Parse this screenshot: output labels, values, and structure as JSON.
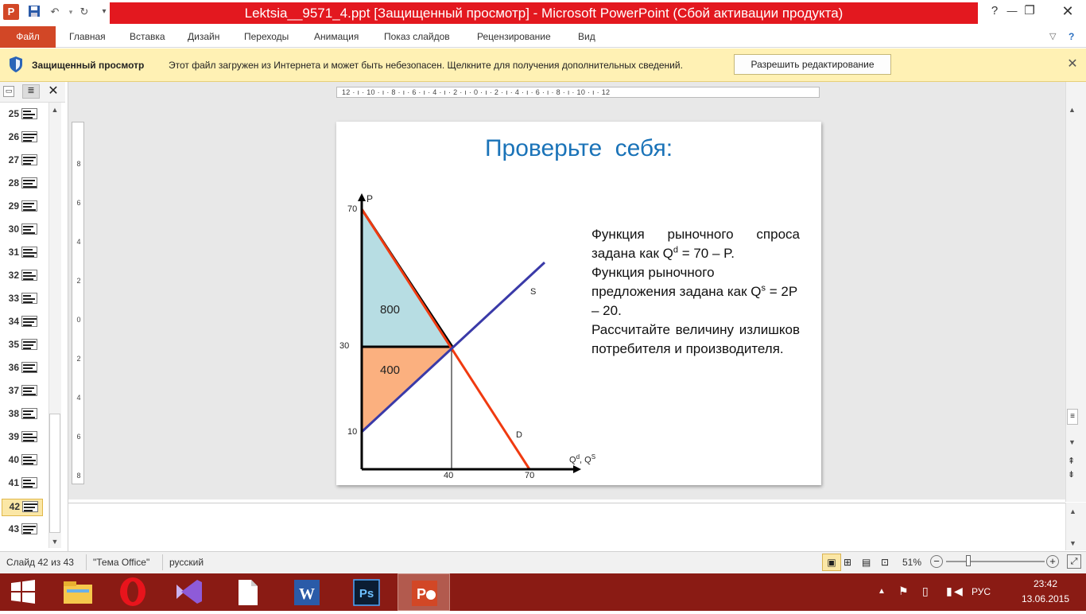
{
  "window": {
    "title": "Lektsia__9571_4.ppt [Защищенный просмотр]  -  Microsoft PowerPoint (Сбой активации продукта)",
    "app_icon_letter": "P"
  },
  "ribbon": {
    "file_tab": "Файл",
    "tabs": [
      "Главная",
      "Вставка",
      "Дизайн",
      "Переходы",
      "Анимация",
      "Показ слайдов",
      "Рецензирование",
      "Вид"
    ]
  },
  "message_bar": {
    "title": "Защищенный просмотр",
    "text": "Этот файл загружен из Интернета и может быть небезопасен. Щелкните для получения дополнительных сведений.",
    "button": "Разрешить редактирование",
    "bg_color": "#fff1b4"
  },
  "slide_thumbnails": [
    {
      "num": "25"
    },
    {
      "num": "26"
    },
    {
      "num": "27"
    },
    {
      "num": "28"
    },
    {
      "num": "29"
    },
    {
      "num": "30"
    },
    {
      "num": "31"
    },
    {
      "num": "32"
    },
    {
      "num": "33"
    },
    {
      "num": "34"
    },
    {
      "num": "35"
    },
    {
      "num": "36"
    },
    {
      "num": "37"
    },
    {
      "num": "38"
    },
    {
      "num": "39"
    },
    {
      "num": "40"
    },
    {
      "num": "41"
    },
    {
      "num": "42",
      "selected": true
    },
    {
      "num": "43"
    }
  ],
  "ruler": {
    "horizontal": "12 · ı · 10 · ı · 8 · ı · 6 · ı · 4 · ı · 2 · ı · 0 · ı · 2 · ı · 4 · ı · 6 · ı · 8 · ı · 10 · ı · 12",
    "vertical": [
      "8",
      "6",
      "4",
      "2",
      "0",
      "2",
      "4",
      "6",
      "8"
    ]
  },
  "slide": {
    "title": "Проверьте себя:",
    "title_color": "#1a73b8",
    "task": {
      "line1": "Функция рыночного спроса задана как Q",
      "line1_sup": "d",
      "line1_end": " = 70 – P.",
      "line2": "Функция рыночного предложения задана как Q",
      "line2_sup": "s",
      "line2_end": " = 2P – 20.",
      "line3": "Рассчитайте величину излишков потребителя и производителя."
    },
    "graph": {
      "y_axis_label": "P",
      "x_axis_label": "Q",
      "x_axis_sup1": "d",
      "x_axis_sep": ", Q",
      "x_axis_sup2": "S",
      "y_ticks": [
        "70",
        "30",
        "10"
      ],
      "x_ticks": [
        "40",
        "70"
      ],
      "supply_label": "S",
      "demand_label": "D",
      "consumer_surplus": "800",
      "producer_surplus": "400",
      "consumer_color": "#b7dde3",
      "producer_color": "#fbb07f",
      "demand_color": "#f03a10",
      "supply_color": "#3a3aa8"
    }
  },
  "status": {
    "slide_info": "Слайд 42 из 43",
    "theme": "\"Тема Office\"",
    "language": "русский",
    "zoom": "51%",
    "zoom_fraction": 0.51
  },
  "taskbar": {
    "lang": "РУС",
    "time": "23:42",
    "date": "13.06.2015"
  }
}
